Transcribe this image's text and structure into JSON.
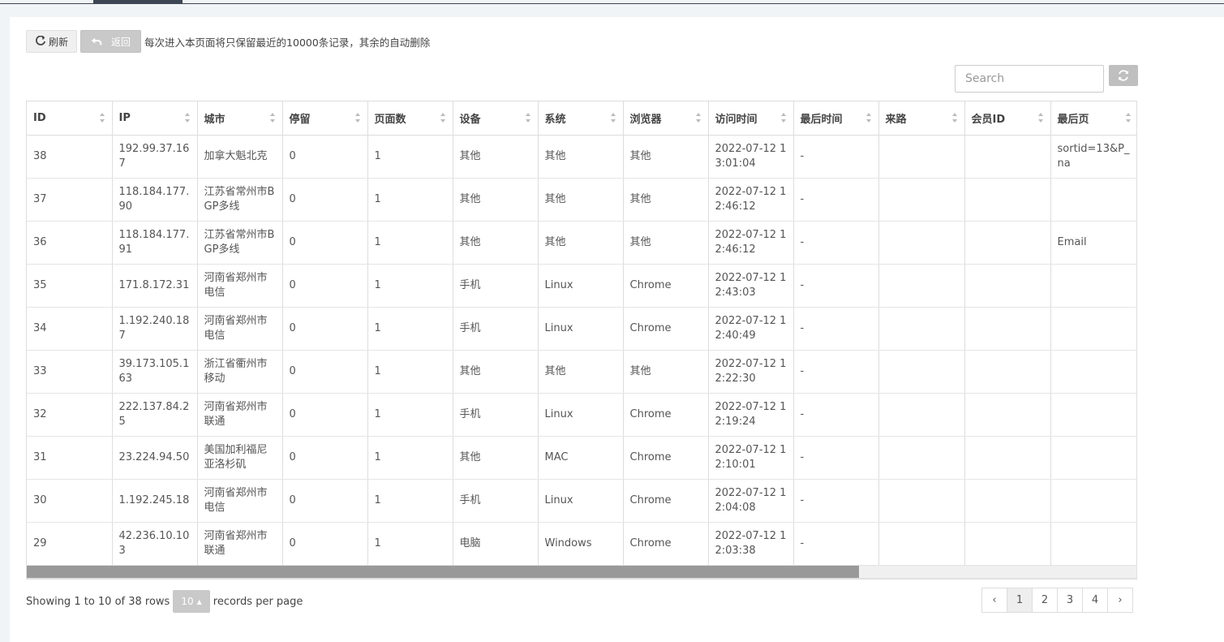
{
  "toolbar": {
    "refresh_label": "刷新",
    "back_label": "返回",
    "notice": "每次进入本页面将只保留最近的10000条记录，其余的自动删除"
  },
  "search": {
    "placeholder": "Search"
  },
  "table": {
    "columns": [
      "ID",
      "IP",
      "城市",
      "停留",
      "页面数",
      "设备",
      "系统",
      "浏览器",
      "访问时间",
      "最后时间",
      "来路",
      "会员ID",
      "最后页"
    ],
    "rows": [
      {
        "id": "38",
        "ip": "192.99.37.167",
        "city": "加拿大魁北克",
        "stay": "0",
        "pages": "1",
        "device": "其他",
        "os": "其他",
        "browser": "其他",
        "visit_time": "2022-07-12 13:01:04",
        "last_time": "-",
        "referer": "",
        "member_id": "",
        "last_page": "sortid=13&P_na"
      },
      {
        "id": "37",
        "ip": "118.184.177.90",
        "city": "江苏省常州市BGP多线",
        "stay": "0",
        "pages": "1",
        "device": "其他",
        "os": "其他",
        "browser": "其他",
        "visit_time": "2022-07-12 12:46:12",
        "last_time": "-",
        "referer": "",
        "member_id": "",
        "last_page": ""
      },
      {
        "id": "36",
        "ip": "118.184.177.91",
        "city": "江苏省常州市BGP多线",
        "stay": "0",
        "pages": "1",
        "device": "其他",
        "os": "其他",
        "browser": "其他",
        "visit_time": "2022-07-12 12:46:12",
        "last_time": "-",
        "referer": "",
        "member_id": "",
        "last_page": "Email"
      },
      {
        "id": "35",
        "ip": "171.8.172.31",
        "city": "河南省郑州市电信",
        "stay": "0",
        "pages": "1",
        "device": "手机",
        "os": "Linux",
        "browser": "Chrome",
        "visit_time": "2022-07-12 12:43:03",
        "last_time": "-",
        "referer": "",
        "member_id": "",
        "last_page": ""
      },
      {
        "id": "34",
        "ip": "1.192.240.187",
        "city": "河南省郑州市电信",
        "stay": "0",
        "pages": "1",
        "device": "手机",
        "os": "Linux",
        "browser": "Chrome",
        "visit_time": "2022-07-12 12:40:49",
        "last_time": "-",
        "referer": "",
        "member_id": "",
        "last_page": ""
      },
      {
        "id": "33",
        "ip": "39.173.105.163",
        "city": "浙江省衢州市移动",
        "stay": "0",
        "pages": "1",
        "device": "其他",
        "os": "其他",
        "browser": "其他",
        "visit_time": "2022-07-12 12:22:30",
        "last_time": "-",
        "referer": "",
        "member_id": "",
        "last_page": ""
      },
      {
        "id": "32",
        "ip": "222.137.84.25",
        "city": "河南省郑州市联通",
        "stay": "0",
        "pages": "1",
        "device": "手机",
        "os": "Linux",
        "browser": "Chrome",
        "visit_time": "2022-07-12 12:19:24",
        "last_time": "-",
        "referer": "",
        "member_id": "",
        "last_page": ""
      },
      {
        "id": "31",
        "ip": "23.224.94.50",
        "city": "美国加利福尼亚洛杉矶",
        "stay": "0",
        "pages": "1",
        "device": "其他",
        "os": "MAC",
        "browser": "Chrome",
        "visit_time": "2022-07-12 12:10:01",
        "last_time": "-",
        "referer": "",
        "member_id": "",
        "last_page": ""
      },
      {
        "id": "30",
        "ip": "1.192.245.18",
        "city": "河南省郑州市电信",
        "stay": "0",
        "pages": "1",
        "device": "手机",
        "os": "Linux",
        "browser": "Chrome",
        "visit_time": "2022-07-12 12:04:08",
        "last_time": "-",
        "referer": "",
        "member_id": "",
        "last_page": ""
      },
      {
        "id": "29",
        "ip": "42.236.10.103",
        "city": "河南省郑州市联通",
        "stay": "0",
        "pages": "1",
        "device": "电脑",
        "os": "Windows",
        "browser": "Chrome",
        "visit_time": "2022-07-12 12:03:38",
        "last_time": "-",
        "referer": "",
        "member_id": "",
        "last_page": ""
      }
    ]
  },
  "footer": {
    "showing_text": "Showing 1 to 10 of 38 rows",
    "page_size": "10",
    "records_per_page": "records per page"
  },
  "pagination": {
    "prev": "‹",
    "pages": [
      "1",
      "2",
      "3",
      "4"
    ],
    "active_page": "1",
    "next": "›"
  },
  "scroll_fraction": 0.75,
  "colors": {
    "top_accent": "#3d4653",
    "button_grey": "#c9c9c9"
  }
}
